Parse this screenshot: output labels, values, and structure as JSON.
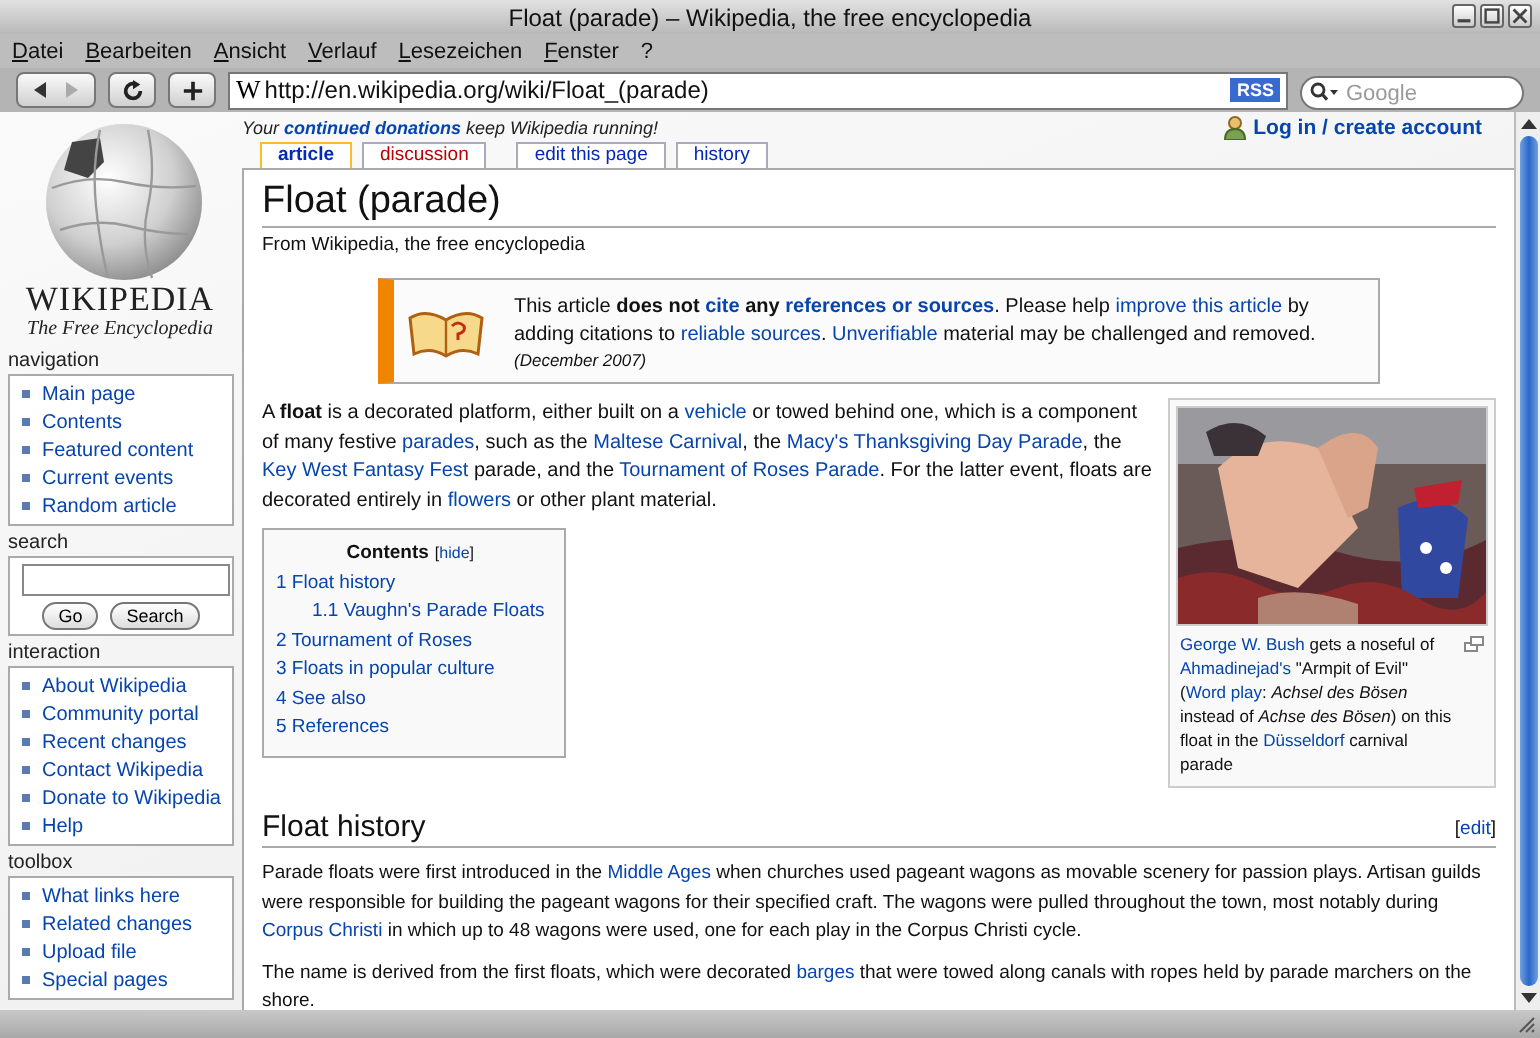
{
  "window": {
    "title": "Float (parade) – Wikipedia, the free encyclopedia"
  },
  "menu": [
    "Datei",
    "Bearbeiten",
    "Ansicht",
    "Verlauf",
    "Lesezeichen",
    "Fenster",
    "?"
  ],
  "address_bar": {
    "favicon": "W",
    "url": "http://en.wikipedia.org/wiki/Float_(parade)",
    "rss": "RSS"
  },
  "search_bar": {
    "placeholder": "Google"
  },
  "logo": {
    "wordmark": "WIKIPEDIA",
    "tagline": "The Free Encyclopedia"
  },
  "sidebar": [
    {
      "heading": "navigation",
      "kind": "links",
      "items": [
        "Main page",
        "Contents",
        "Featured content",
        "Current events",
        "Random article"
      ]
    },
    {
      "heading": "search",
      "kind": "search",
      "buttons": [
        "Go",
        "Search"
      ]
    },
    {
      "heading": "interaction",
      "kind": "links",
      "items": [
        "About Wikipedia",
        "Community portal",
        "Recent changes",
        "Contact Wikipedia",
        "Donate to Wikipedia",
        "Help"
      ]
    },
    {
      "heading": "toolbox",
      "kind": "links",
      "items": [
        "What links here",
        "Related changes",
        "Upload file",
        "Special pages"
      ]
    }
  ],
  "site_notice": [
    {
      "kind": "text",
      "text": "Your "
    },
    {
      "kind": "bold-link",
      "text": "continued donations"
    },
    {
      "kind": "text",
      "text": " keep Wikipedia running!"
    }
  ],
  "user_link": "Log in / create account",
  "tabs": [
    {
      "label": "article",
      "selected": true,
      "missing": false
    },
    {
      "label": "discussion",
      "selected": false,
      "missing": true
    },
    {
      "label": "edit this page",
      "selected": false,
      "missing": false
    },
    {
      "label": "history",
      "selected": false,
      "missing": false
    }
  ],
  "title": "Float (parade)",
  "subtitle": "From Wikipedia, the free encyclopedia",
  "notice": {
    "lines": [
      [
        {
          "kind": "text",
          "text": "This article "
        },
        {
          "kind": "bold",
          "text": "does not "
        },
        {
          "kind": "bold-link",
          "text": "cite"
        },
        {
          "kind": "bold",
          "text": " any "
        },
        {
          "kind": "bold-link",
          "text": "references or sources"
        },
        {
          "kind": "text",
          "text": ". Please help "
        },
        {
          "kind": "link",
          "text": "improve this article"
        },
        {
          "kind": "text",
          "text": " by adding citations to "
        },
        {
          "kind": "link",
          "text": "reliable sources"
        },
        {
          "kind": "text",
          "text": ". "
        },
        {
          "kind": "link",
          "text": "Unverifiable"
        },
        {
          "kind": "text",
          "text": " material may be challenged and removed."
        }
      ]
    ],
    "date": "(December 2007)"
  },
  "intro": [
    {
      "kind": "text",
      "text": "A "
    },
    {
      "kind": "bold",
      "text": "float"
    },
    {
      "kind": "text",
      "text": " is a decorated platform, either built on a "
    },
    {
      "kind": "link",
      "text": "vehicle"
    },
    {
      "kind": "text",
      "text": " or towed behind one, which is a component of many festive "
    },
    {
      "kind": "link",
      "text": "parades"
    },
    {
      "kind": "text",
      "text": ", such as the "
    },
    {
      "kind": "link",
      "text": "Maltese Carnival"
    },
    {
      "kind": "text",
      "text": ", the "
    },
    {
      "kind": "link",
      "text": "Macy's Thanksgiving Day Parade"
    },
    {
      "kind": "text",
      "text": ", the "
    },
    {
      "kind": "link",
      "text": "Key West Fantasy Fest"
    },
    {
      "kind": "text",
      "text": " parade, and the "
    },
    {
      "kind": "link",
      "text": "Tournament of Roses Parade"
    },
    {
      "kind": "text",
      "text": ". For the latter event, floats are decorated entirely in "
    },
    {
      "kind": "link",
      "text": "flowers"
    },
    {
      "kind": "text",
      "text": " or other plant material."
    }
  ],
  "figure": {
    "kind": "picture",
    "caption": [
      {
        "kind": "link",
        "text": "George W. Bush"
      },
      {
        "kind": "text",
        "text": " gets a noseful of "
      },
      {
        "kind": "link",
        "text": "Ahmadinejad's"
      },
      {
        "kind": "text",
        "text": " \"Armpit of Evil\" ("
      },
      {
        "kind": "link",
        "text": "Word play"
      },
      {
        "kind": "text",
        "text": ": "
      },
      {
        "kind": "italic",
        "text": "Achsel des Bösen"
      },
      {
        "kind": "text",
        "text": " instead of "
      },
      {
        "kind": "italic",
        "text": "Achse des Bösen"
      },
      {
        "kind": "text",
        "text": ") on this float in the "
      },
      {
        "kind": "link",
        "text": "Düsseldorf"
      },
      {
        "kind": "text",
        "text": " carnival parade"
      }
    ]
  },
  "toc": {
    "title": "Contents",
    "toggle": [
      {
        "kind": "text",
        "text": "["
      },
      {
        "kind": "link",
        "text": "hide"
      },
      {
        "kind": "text",
        "text": "]"
      }
    ],
    "entries": [
      {
        "text": "1 Float history",
        "children": [
          {
            "text": "1.1 Vaughn's Parade Floats"
          }
        ]
      },
      {
        "text": "2 Tournament of Roses"
      },
      {
        "text": "3 Floats in popular culture"
      },
      {
        "text": "4 See also"
      },
      {
        "text": "5 References"
      }
    ]
  },
  "section": {
    "heading": "Float history",
    "edit": [
      {
        "kind": "text",
        "text": "["
      },
      {
        "kind": "link",
        "text": "edit"
      },
      {
        "kind": "text",
        "text": "]"
      }
    ],
    "paragraphs": [
      [
        {
          "kind": "text",
          "text": "Parade floats were first introduced in the "
        },
        {
          "kind": "link",
          "text": "Middle Ages"
        },
        {
          "kind": "text",
          "text": " when churches used pageant wagons as movable scenery for passion plays. Artisan guilds were responsible for building the pageant wagons for their specified craft. The wagons were pulled throughout the town, most notably during "
        },
        {
          "kind": "link",
          "text": "Corpus Christi"
        },
        {
          "kind": "text",
          "text": " in which up to 48 wagons were used, one for each play in the Corpus Christi cycle."
        }
      ],
      [
        {
          "kind": "text",
          "text": "The name is derived from the first floats, which were decorated "
        },
        {
          "kind": "link",
          "text": "barges"
        },
        {
          "kind": "text",
          "text": " that were towed along canals with ropes held by parade marchers on the shore."
        }
      ]
    ]
  }
}
